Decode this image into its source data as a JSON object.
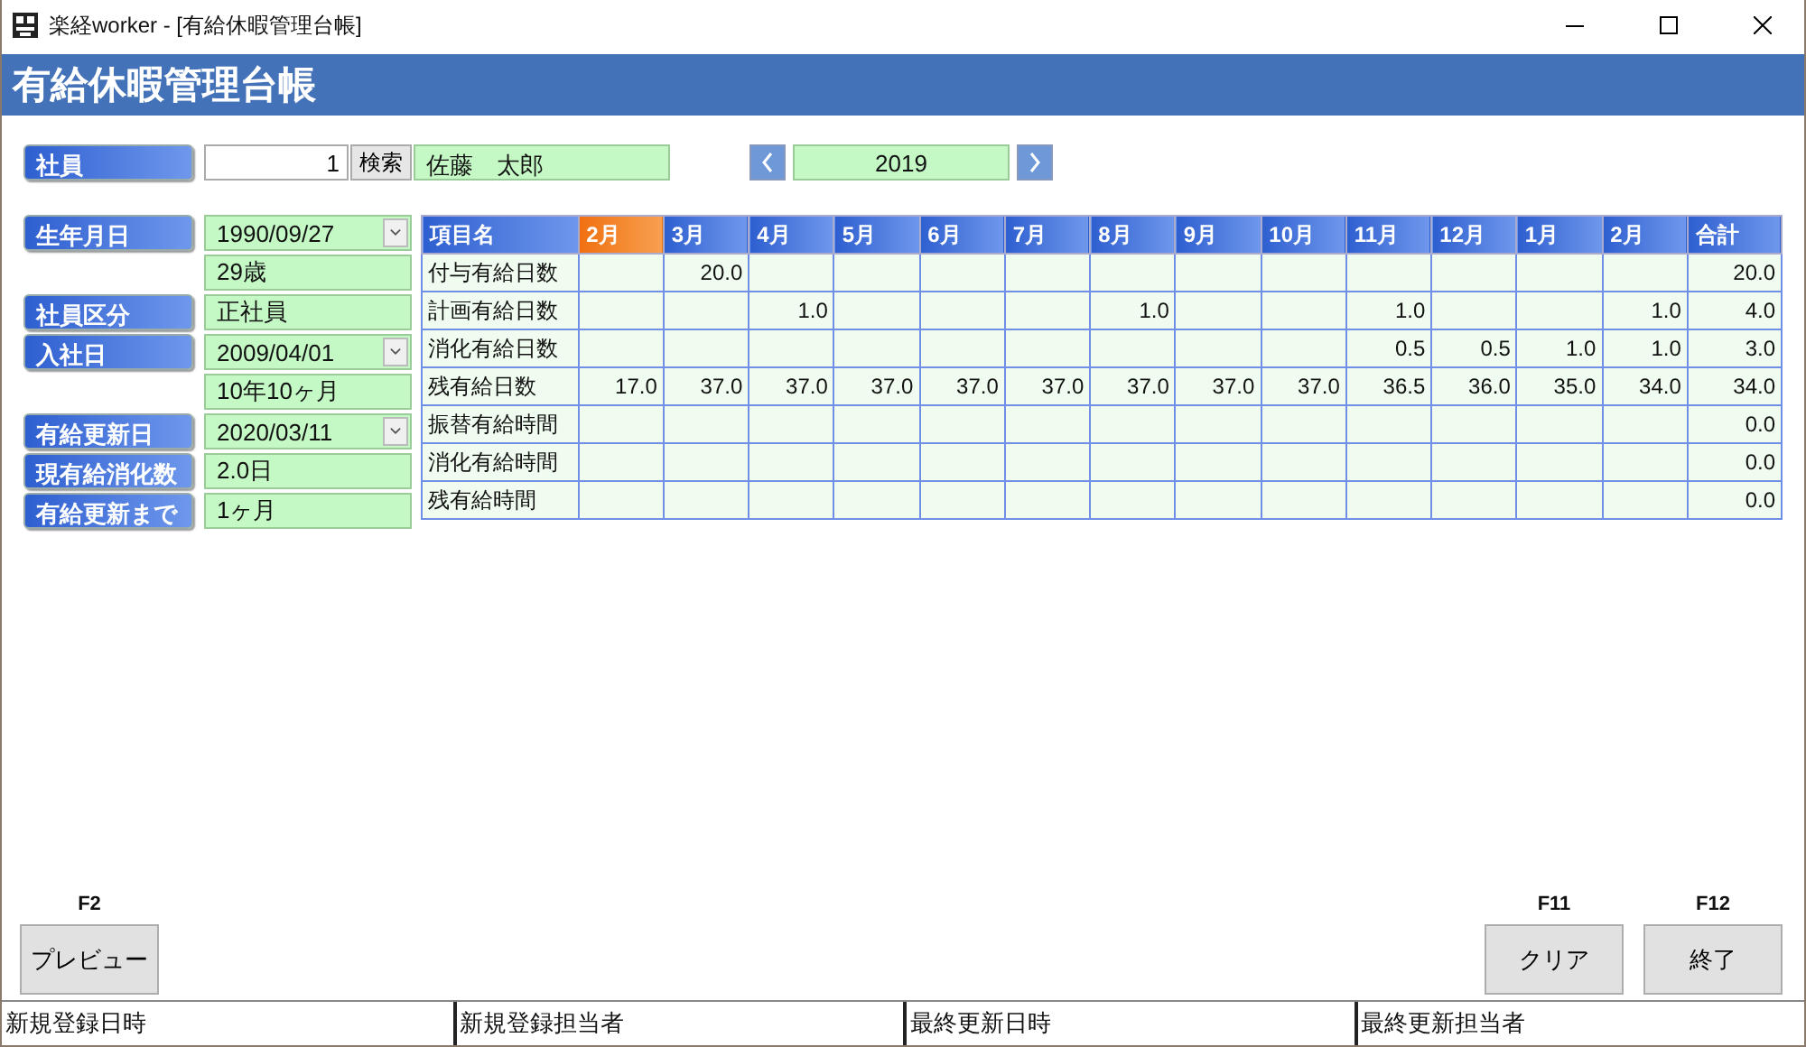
{
  "window": {
    "title": "楽経worker - [有給休暇管理台帳]"
  },
  "header": {
    "title": "有給休暇管理台帳"
  },
  "employee": {
    "label": "社員",
    "id": "1",
    "search_button": "検索",
    "name": "佐藤　太郎"
  },
  "year_nav": {
    "year": "2019"
  },
  "fields": [
    {
      "label": "生年月日",
      "value": "1990/09/27",
      "kind": "dropdown"
    },
    {
      "value": "29歳",
      "kind": "plain"
    },
    {
      "label": "社員区分",
      "value": "正社員",
      "kind": "plain"
    },
    {
      "label": "入社日",
      "value": "2009/04/01",
      "kind": "dropdown"
    },
    {
      "value": "10年10ヶ月",
      "kind": "plain"
    },
    {
      "label": "有給更新日",
      "value": "2020/03/11",
      "kind": "dropdown"
    },
    {
      "label": "現有給消化数",
      "value": "2.0日",
      "kind": "plain"
    },
    {
      "label": "有給更新まで",
      "value": "1ヶ月",
      "kind": "plain"
    }
  ],
  "table": {
    "columns": [
      {
        "label": "項目名",
        "selected": false
      },
      {
        "label": "2月",
        "selected": true
      },
      {
        "label": "3月",
        "selected": false
      },
      {
        "label": "4月",
        "selected": false
      },
      {
        "label": "5月",
        "selected": false
      },
      {
        "label": "6月",
        "selected": false
      },
      {
        "label": "7月",
        "selected": false
      },
      {
        "label": "8月",
        "selected": false
      },
      {
        "label": "9月",
        "selected": false
      },
      {
        "label": "10月",
        "selected": false
      },
      {
        "label": "11月",
        "selected": false
      },
      {
        "label": "12月",
        "selected": false
      },
      {
        "label": "1月",
        "selected": false
      },
      {
        "label": "2月",
        "selected": false
      },
      {
        "label": "合計",
        "selected": false
      }
    ],
    "rows": [
      {
        "cells": [
          "付与有給日数",
          "",
          "20.0",
          "",
          "",
          "",
          "",
          "",
          "",
          "",
          "",
          "",
          "",
          "",
          "20.0"
        ]
      },
      {
        "cells": [
          "計画有給日数",
          "",
          "",
          "1.0",
          "",
          "",
          "",
          "1.0",
          "",
          "",
          "1.0",
          "",
          "",
          "1.0",
          "4.0"
        ]
      },
      {
        "cells": [
          "消化有給日数",
          "",
          "",
          "",
          "",
          "",
          "",
          "",
          "",
          "",
          "0.5",
          "0.5",
          "1.0",
          "1.0",
          "3.0"
        ]
      },
      {
        "cells": [
          "残有給日数",
          "17.0",
          "37.0",
          "37.0",
          "37.0",
          "37.0",
          "37.0",
          "37.0",
          "37.0",
          "37.0",
          "36.5",
          "36.0",
          "35.0",
          "34.0",
          "34.0"
        ]
      },
      {
        "cells": [
          "振替有給時間",
          "",
          "",
          "",
          "",
          "",
          "",
          "",
          "",
          "",
          "",
          "",
          "",
          "",
          "0.0"
        ]
      },
      {
        "cells": [
          "消化有給時間",
          "",
          "",
          "",
          "",
          "",
          "",
          "",
          "",
          "",
          "",
          "",
          "",
          "",
          "0.0"
        ]
      },
      {
        "cells": [
          "残有給時間",
          "",
          "",
          "",
          "",
          "",
          "",
          "",
          "",
          "",
          "",
          "",
          "",
          "",
          "0.0"
        ]
      }
    ]
  },
  "buttons_left": [
    {
      "key": "F2",
      "label": "プレビュー"
    }
  ],
  "buttons_right": [
    {
      "key": "F11",
      "label": "クリア"
    },
    {
      "key": "F12",
      "label": "終了"
    }
  ],
  "status_bar": [
    "新規登録日時",
    "新規登録担当者",
    "最終更新日時",
    "最終更新担当者"
  ]
}
